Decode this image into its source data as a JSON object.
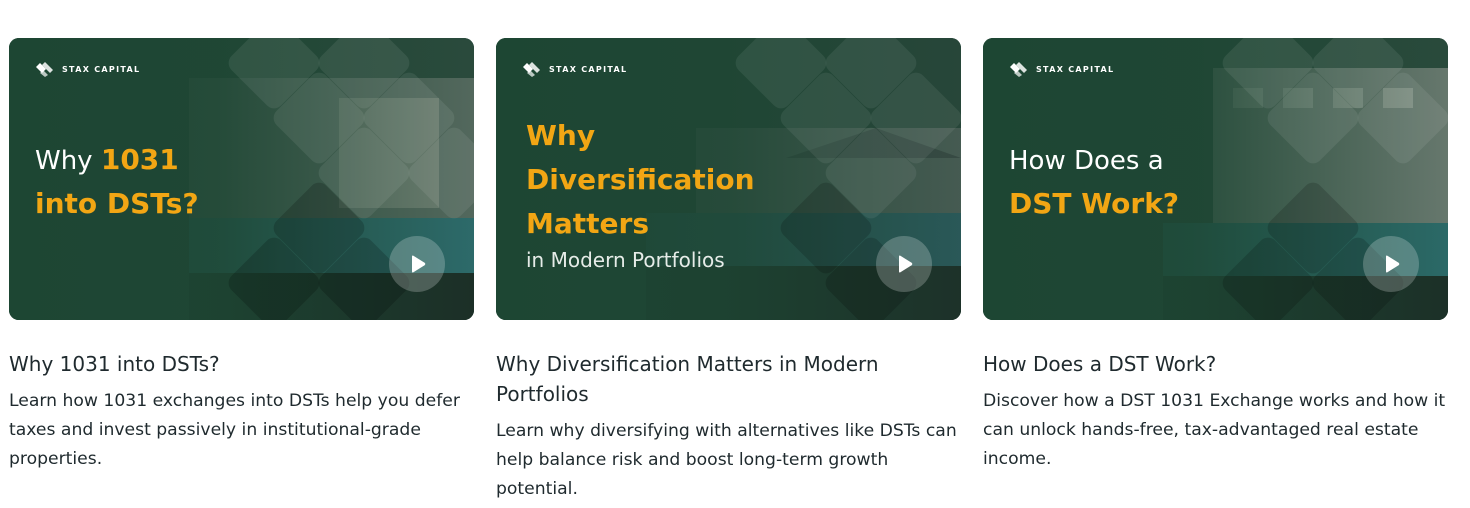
{
  "brand": {
    "name": "STAX CAPITAL",
    "logo_icon": "stax-capital-logo-icon",
    "accent_color": "#f2a614",
    "card_bg_color": "#173a2b"
  },
  "cards": [
    {
      "thumbnail": {
        "lines": [
          {
            "white": "Why ",
            "gold": "1031"
          },
          {
            "white": "",
            "gold": "into DSTs?"
          }
        ],
        "sub": ""
      },
      "play_icon": "play-icon",
      "title": "Why 1031 into DSTs?",
      "description": "Learn how 1031 exchanges into DSTs help you defer taxes and invest passively in institutional-grade properties."
    },
    {
      "thumbnail": {
        "lines": [
          {
            "white": "",
            "gold": "Why"
          },
          {
            "white": "",
            "gold": "Diversification"
          },
          {
            "white": "",
            "gold": "Matters"
          }
        ],
        "sub": "in Modern Portfolios"
      },
      "play_icon": "play-icon",
      "title": "Why Diversification Matters in Modern Portfolios",
      "description": "Learn why diversifying with alternatives like DSTs can help balance risk and boost long-term growth potential."
    },
    {
      "thumbnail": {
        "lines": [
          {
            "white": "How Does a",
            "gold": ""
          },
          {
            "white": "",
            "gold": "DST Work?"
          }
        ],
        "sub": ""
      },
      "play_icon": "play-icon",
      "title": "How Does a DST Work?",
      "description": "Discover how a DST 1031 Exchange works and how it can unlock hands-free, tax-advantaged real estate income."
    }
  ]
}
